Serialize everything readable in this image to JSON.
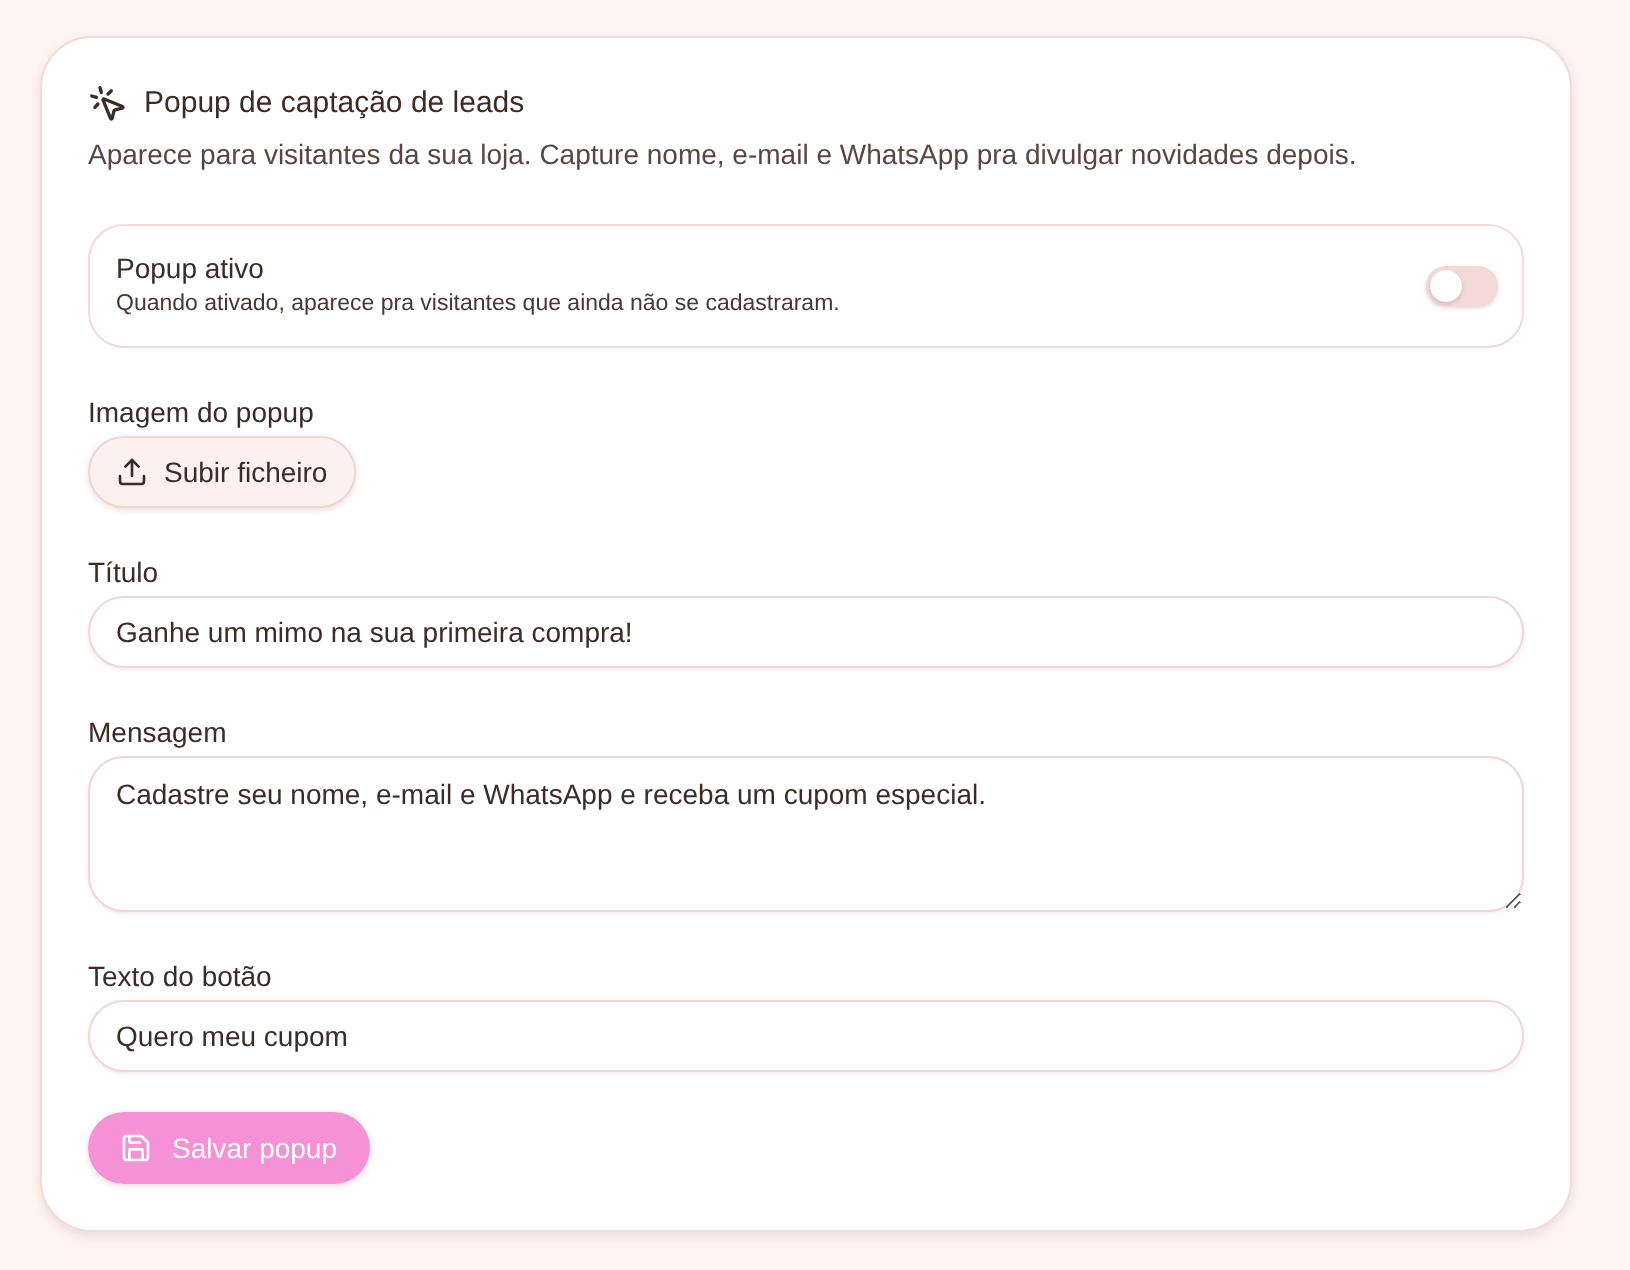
{
  "section": {
    "title": "Popup de captação de leads",
    "description": "Aparece para visitantes da sua loja. Capture nome, e-mail e WhatsApp pra divulgar novidades depois."
  },
  "toggle": {
    "label": "Popup ativo",
    "hint": "Quando ativado, aparece pra visitantes que ainda não se cadastraram.",
    "on": false
  },
  "image_field": {
    "label": "Imagem do popup",
    "button": "Subir ficheiro"
  },
  "fields": [
    {
      "kind": "input",
      "label": "Título",
      "value": "Ganhe um mimo na sua primeira compra!"
    },
    {
      "kind": "textarea",
      "label": "Mensagem",
      "value": "Cadastre seu nome, e-mail e WhatsApp e receba um cupom especial."
    },
    {
      "kind": "input",
      "label": "Texto do botão",
      "value": "Quero meu cupom"
    }
  ],
  "save_button": {
    "label": "Salvar popup",
    "disabled": true
  }
}
